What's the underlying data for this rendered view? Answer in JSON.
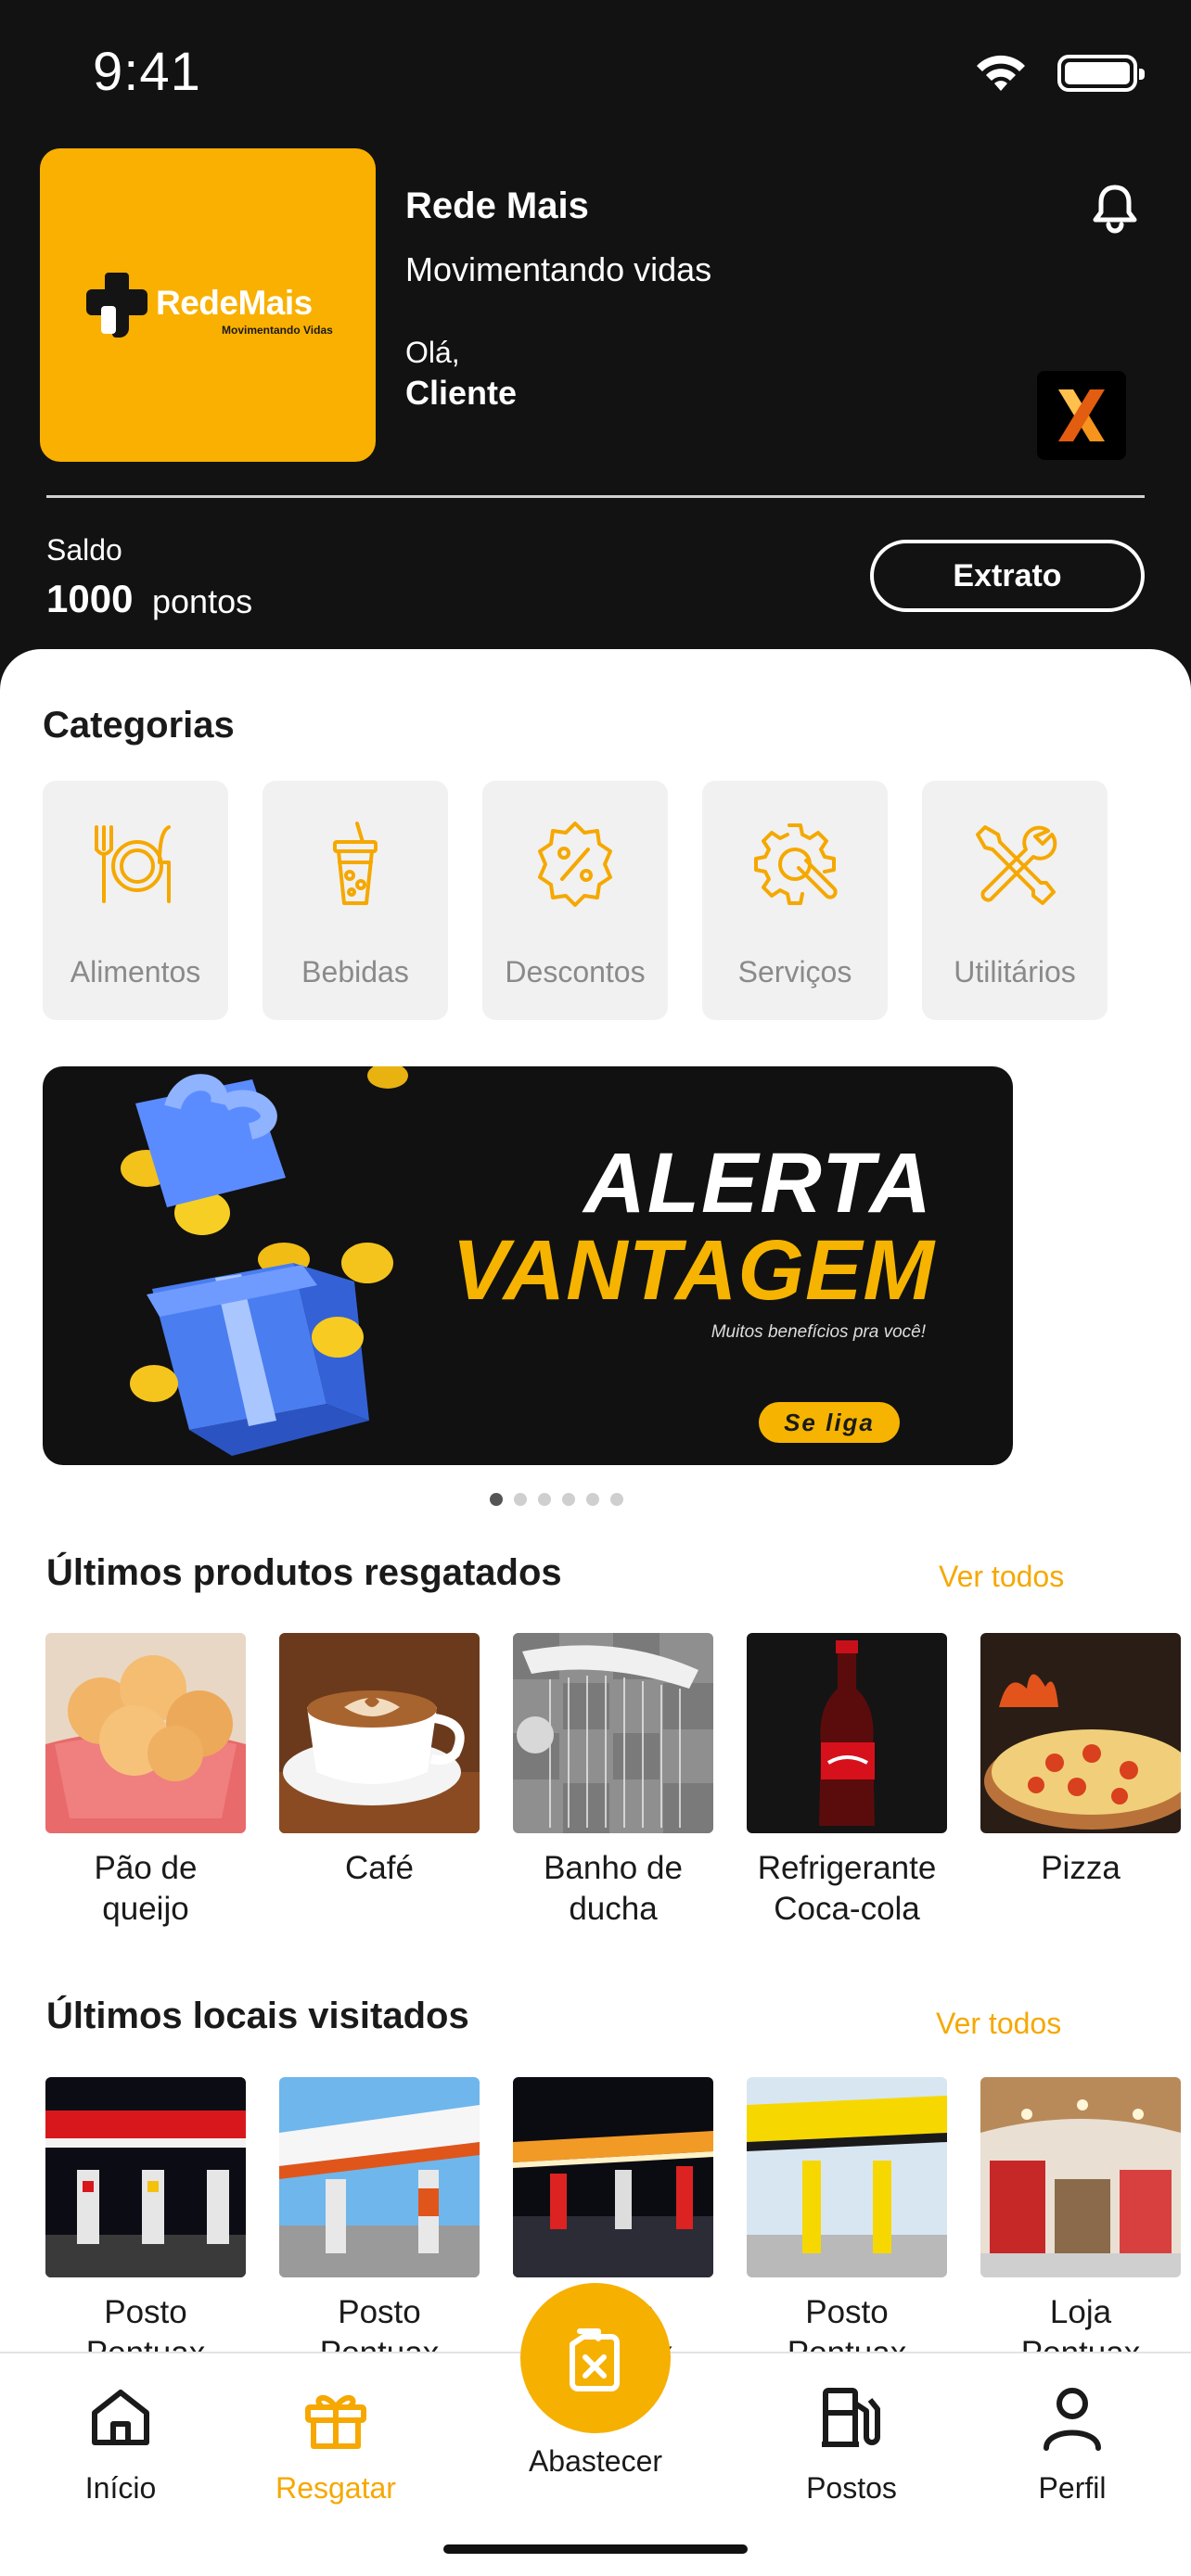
{
  "status_bar": {
    "time": "9:41"
  },
  "header": {
    "logo_text": "RedeMais",
    "logo_sub": "Movimentando Vidas",
    "brand_name": "Rede Mais",
    "tagline": "Movimentando vidas",
    "greeting": "Olá,",
    "user_name": "Cliente",
    "partner_badge": "X",
    "balance_label": "Saldo",
    "balance_value": "1000",
    "balance_unit": "pontos",
    "statement_button": "Extrato"
  },
  "categories": {
    "title": "Categorias",
    "items": [
      {
        "label": "Alimentos",
        "icon": "plate-cutlery-icon"
      },
      {
        "label": "Bebidas",
        "icon": "drink-cup-icon"
      },
      {
        "label": "Descontos",
        "icon": "percent-badge-icon"
      },
      {
        "label": "Serviços",
        "icon": "gear-wrench-icon"
      },
      {
        "label": "Utilitários",
        "icon": "tools-icon"
      }
    ]
  },
  "banner": {
    "line1": "ALERTA",
    "line2": "VANTAGEM",
    "subtitle": "Muitos benefícios pra você!",
    "cta": "Se liga",
    "carousel_total": 6,
    "carousel_active": 1
  },
  "products": {
    "title": "Últimos produtos resgatados",
    "see_all": "Ver todos",
    "items": [
      {
        "line1": "Pão de",
        "line2": "queijo"
      },
      {
        "line1": "Café",
        "line2": ""
      },
      {
        "line1": "Banho de",
        "line2": "ducha"
      },
      {
        "line1": "Refrigerante",
        "line2": "Coca-cola"
      },
      {
        "line1": "Pizza",
        "line2": ""
      }
    ]
  },
  "places": {
    "title": "Últimos locais visitados",
    "see_all": "Ver todos",
    "items": [
      {
        "line1": "Posto",
        "line2": "Pontuax"
      },
      {
        "line1": "Posto",
        "line2": "Pontuax"
      },
      {
        "line1": "Posto",
        "line2": "Pontuax"
      },
      {
        "line1": "Posto",
        "line2": "Pontuax"
      },
      {
        "line1": "Loja",
        "line2": "Pontuax"
      }
    ]
  },
  "nav": {
    "items": [
      {
        "label": "Início",
        "icon": "home-icon"
      },
      {
        "label": "Resgatar",
        "icon": "gift-icon",
        "active": true
      },
      {
        "label": "Abastecer",
        "icon": "fuel-can-icon"
      },
      {
        "label": "Postos",
        "icon": "gas-pump-icon"
      },
      {
        "label": "Perfil",
        "icon": "user-icon"
      }
    ]
  },
  "colors": {
    "accent": "#f6b000",
    "header_bg": "#121212",
    "card_bg": "#f1f1f1"
  }
}
